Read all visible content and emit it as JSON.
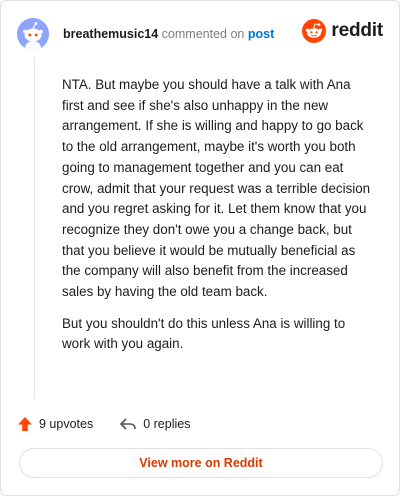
{
  "header": {
    "username": "breathemusic14",
    "action_text": "commented on",
    "post_link_label": "post",
    "brand_name": "reddit",
    "avatar_icon": "snoo-avatar-icon",
    "brand_icon": "reddit-logo-icon"
  },
  "comment": {
    "paragraphs": [
      "NTA. But maybe you should have a talk with Ana first and see if she's also unhappy in the new arrangement. If she is willing and happy to go back to the old arrangement, maybe it's worth you both going to management together and you can eat crow, admit that your request was a terrible decision and you regret asking for it. Let them know that you recognize they don't owe you a change back, but that you believe it would be mutually beneficial as the company will also benefit from the increased sales by having the old team back.",
      "But you shouldn't do this unless Ana is willing to work with you again."
    ]
  },
  "actions": {
    "upvotes_label": "9 upvotes",
    "replies_label": "0 replies"
  },
  "footer": {
    "view_more_label": "View more on Reddit"
  },
  "colors": {
    "accent": "#ff4500",
    "link": "#0079d3",
    "view_more_text": "#d93a00",
    "avatar_bg": "#8ea4ff"
  }
}
